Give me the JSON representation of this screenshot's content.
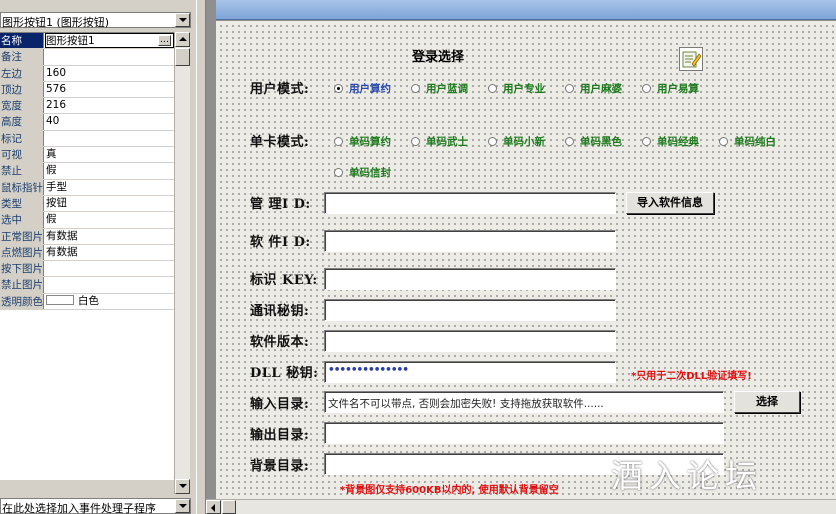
{
  "object_selector": {
    "value": "图形按钮1 (图形按钮)"
  },
  "properties": [
    {
      "name": "名称",
      "value": "图形按钮1",
      "selected": true
    },
    {
      "name": "备注",
      "value": ""
    },
    {
      "name": "左边",
      "value": "160"
    },
    {
      "name": "顶边",
      "value": "576"
    },
    {
      "name": "宽度",
      "value": "216"
    },
    {
      "name": "高度",
      "value": "40"
    },
    {
      "name": "标记",
      "value": ""
    },
    {
      "name": "可视",
      "value": "真"
    },
    {
      "name": "禁止",
      "value": "假"
    },
    {
      "name": "鼠标指针",
      "value": "手型"
    },
    {
      "name": "类型",
      "value": "按钮"
    },
    {
      "name": "选中",
      "value": "假"
    },
    {
      "name": "正常图片",
      "value": "有数据"
    },
    {
      "name": "点燃图片",
      "value": "有数据"
    },
    {
      "name": "按下图片",
      "value": ""
    },
    {
      "name": "禁止图片",
      "value": ""
    },
    {
      "name": "透明颜色",
      "value": "白色",
      "swatch": "#ffffff"
    }
  ],
  "event_selector": {
    "value": "在此处选择加入事件处理子程序"
  },
  "form": {
    "title": "登录选择",
    "user_mode": {
      "label": "用户模式:",
      "options": [
        "用户算约",
        "用户蓝调",
        "用户专业",
        "用户麻婆",
        "用户易算"
      ]
    },
    "card_mode": {
      "label": "单卡模式:",
      "options": [
        "单码算约",
        "单码武士",
        "单码小新",
        "单码黑色",
        "单码经典",
        "单码纯白",
        "单码信封"
      ]
    },
    "admin_id": {
      "label": "管 理I D:",
      "value": ""
    },
    "import_button": "导入软件信息",
    "software_id": {
      "label": "软 件I D:",
      "value": ""
    },
    "key": {
      "label": "标识 KEY:",
      "value": ""
    },
    "comm_secret": {
      "label": "通讯秘钥:",
      "value": ""
    },
    "version": {
      "label": "软件版本:",
      "value": ""
    },
    "dll_secret": {
      "label": "DLL 秘钥:",
      "value": "••••••••••••••"
    },
    "dll_note": "*只用于二次DLL验证填写!",
    "input_dir": {
      "label": "输入目录:",
      "value": "文件名不可以带点, 否则会加密失败! 支持拖放获取软件......"
    },
    "select_button": "选择",
    "output_dir": {
      "label": "输出目录:",
      "value": ""
    },
    "bg_dir": {
      "label": "背景目录:",
      "value": ""
    },
    "bg_note": "*背景图仅支持600KB以内的, 使用默认背景留空"
  },
  "watermark": "酒入论坛",
  "colors": {
    "note_red": "#e01010",
    "radio_green": "#1e7a1e",
    "selection": "#0a246a"
  }
}
